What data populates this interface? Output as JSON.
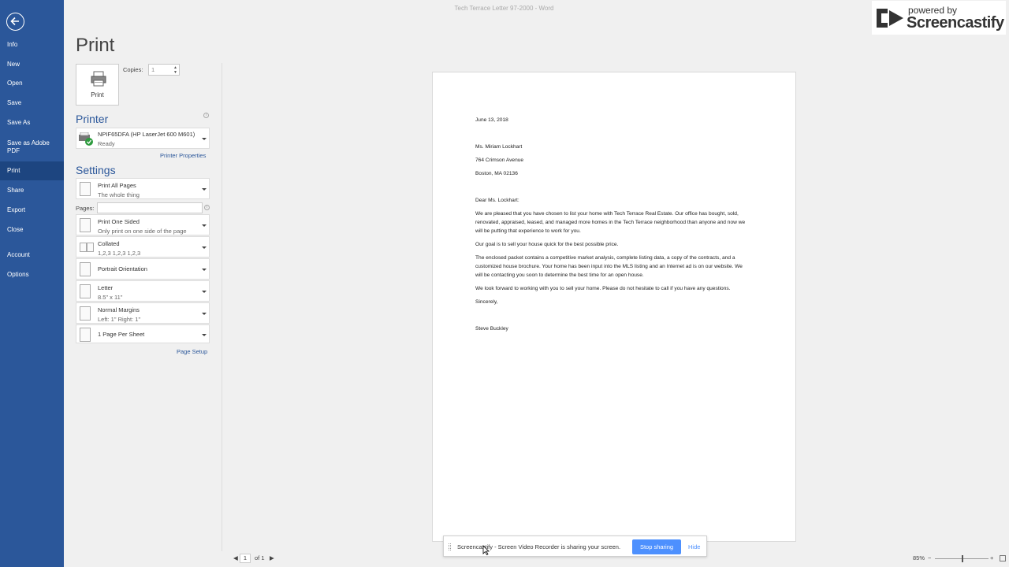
{
  "window": {
    "title": "Tech Terrace Letter 97-2000  -  Word"
  },
  "sidebar": {
    "items": [
      {
        "label": "Info"
      },
      {
        "label": "New"
      },
      {
        "label": "Open"
      },
      {
        "label": "Save"
      },
      {
        "label": "Save As"
      },
      {
        "label": "Save as Adobe PDF"
      },
      {
        "label": "Print"
      },
      {
        "label": "Share"
      },
      {
        "label": "Export"
      },
      {
        "label": "Close"
      },
      {
        "label": "Account"
      },
      {
        "label": "Options"
      }
    ],
    "selected": "Print",
    "bg_color": "#2b579a"
  },
  "print_panel": {
    "heading": "Print",
    "print_button_label": "Print",
    "copies_label": "Copies:",
    "copies_value": "1",
    "printer_heading": "Printer",
    "printer_name": "NPIF65DFA (HP LaserJet 600 M601)",
    "printer_status": "Ready",
    "printer_properties_link": "Printer Properties",
    "settings_heading": "Settings",
    "pages_label": "Pages:",
    "pages_value": "",
    "page_setup_link": "Page Setup",
    "settings": [
      {
        "line1": "Print All Pages",
        "line2": "The whole thing"
      },
      {
        "line1": "Print One Sided",
        "line2": "Only print on one side of the page"
      },
      {
        "line1": "Collated",
        "line2": "1,2,3     1,2,3     1,2,3"
      },
      {
        "line1": "Portrait Orientation",
        "line2": ""
      },
      {
        "line1": "Letter",
        "line2": "8.5\" x 11\""
      },
      {
        "line1": "Normal Margins",
        "line2": "Left:  1\"     Right:  1\""
      },
      {
        "line1": "1 Page Per Sheet",
        "line2": ""
      }
    ]
  },
  "preview": {
    "date": "June 13, 2018",
    "recipient_name": "Ms. Miriam Lockhart",
    "recipient_street": "764 Crimson Avenue",
    "recipient_city": "Boston, MA 02136",
    "salutation": "Dear Ms. Lockhart:",
    "para1": "We are pleased that you have chosen to list your home with Tech Terrace Real Estate.  Our office has bought, sold, renovated, appraised, leased, and managed more homes in the Tech Terrace neighborhood than anyone and now we will be putting that experience to work for you.",
    "para2": "Our goal is to sell your house quick for the best possible price.",
    "para3": "The enclosed packet contains a competitive market analysis, complete listing data, a copy of the contracts, and a customized house brochure.  Your home has been input into the MLS listing and an Internet ad is on our website.  We will be contacting you soon to determine the best time for an open house.",
    "para4": "We look forward to working with you to sell your home. Please do not hesitate to call if you have any questions.",
    "closing": "Sincerely,",
    "signature": "Steve Buckley"
  },
  "page_nav": {
    "current": "1",
    "total_label": "of 1"
  },
  "zoom": {
    "level": "85%",
    "slider_fraction": 0.5
  },
  "watermark": {
    "powered": "powered by",
    "brand": "Screencastify"
  },
  "share_bar": {
    "message": "Screencastify - Screen Video Recorder is sharing your screen.",
    "stop_label": "Stop sharing",
    "hide_label": "Hide",
    "accent": "#4d90fe"
  }
}
